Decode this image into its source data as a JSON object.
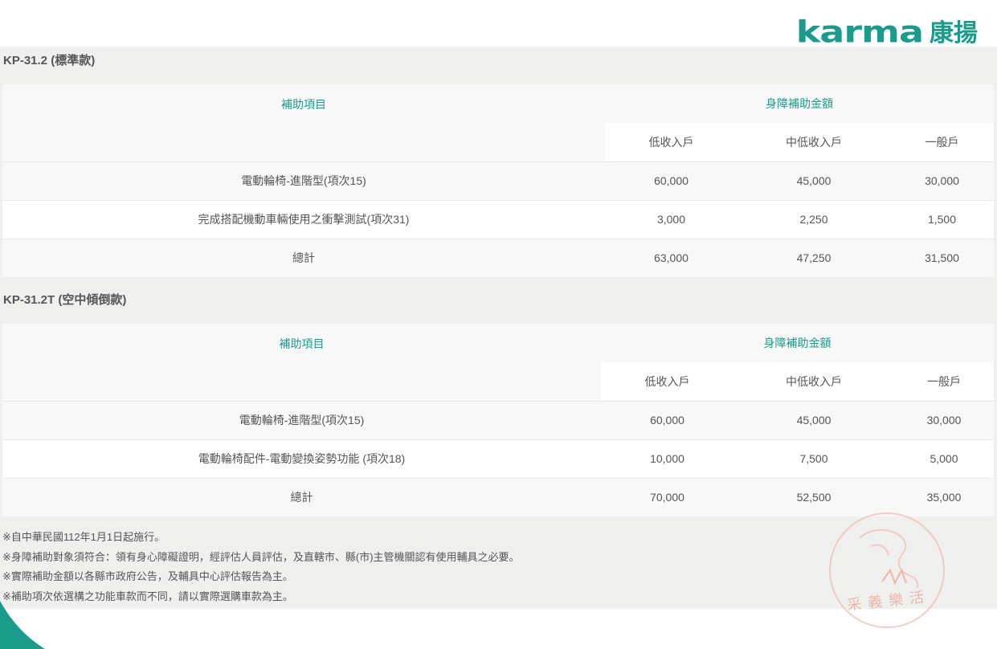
{
  "brand": {
    "latin": "karma",
    "cjk": "康揚"
  },
  "sections": [
    {
      "title": "KP-31.2 (標準款)",
      "header": {
        "item": "補助項目",
        "amount": "身障補助金額",
        "low": "低收入戶",
        "mid": "中低收入戶",
        "general": "一般戶"
      },
      "rows": [
        {
          "item": "電動輪椅-進階型(項次15)",
          "low": "60,000",
          "mid": "45,000",
          "general": "30,000"
        },
        {
          "item": "完成搭配機動車輛使用之衝擊測試(項次31)",
          "low": "3,000",
          "mid": "2,250",
          "general": "1,500"
        },
        {
          "item": "總計",
          "low": "63,000",
          "mid": "47,250",
          "general": "31,500"
        }
      ]
    },
    {
      "title": "KP-31.2T (空中傾倒款)",
      "header": {
        "item": "補助項目",
        "amount": "身障補助金額",
        "low": "低收入戶",
        "mid": "中低收入戶",
        "general": "一般戶"
      },
      "rows": [
        {
          "item": "電動輪椅-進階型(項次15)",
          "low": "60,000",
          "mid": "45,000",
          "general": "30,000"
        },
        {
          "item": "電動輪椅配件-電動變換姿勢功能 (項次18)",
          "low": "10,000",
          "mid": "7,500",
          "general": "5,000"
        },
        {
          "item": "總計",
          "low": "70,000",
          "mid": "52,500",
          "general": "35,000"
        }
      ]
    }
  ],
  "notes": [
    "※自中華民國112年1月1日起施行。",
    "※身障補助對象須符合：領有身心障礙證明，經評估人員評估，及直轄市、縣(市)主管機關認有使用輔具之必要。",
    "※實際補助金額以各縣市政府公告，及輔具中心評估報告為主。",
    "※補助項次依選構之功能車款而不同，請以實際選購車款為主。"
  ],
  "stamp": {
    "text": "采義樂活"
  },
  "colors": {
    "accent": "#1a9b8c",
    "background": "#efefee",
    "text": "#555555",
    "stamp": "#e9a898"
  },
  "icons": {
    "stamp": "seal-icon",
    "corner": "corner-decoration-icon"
  }
}
